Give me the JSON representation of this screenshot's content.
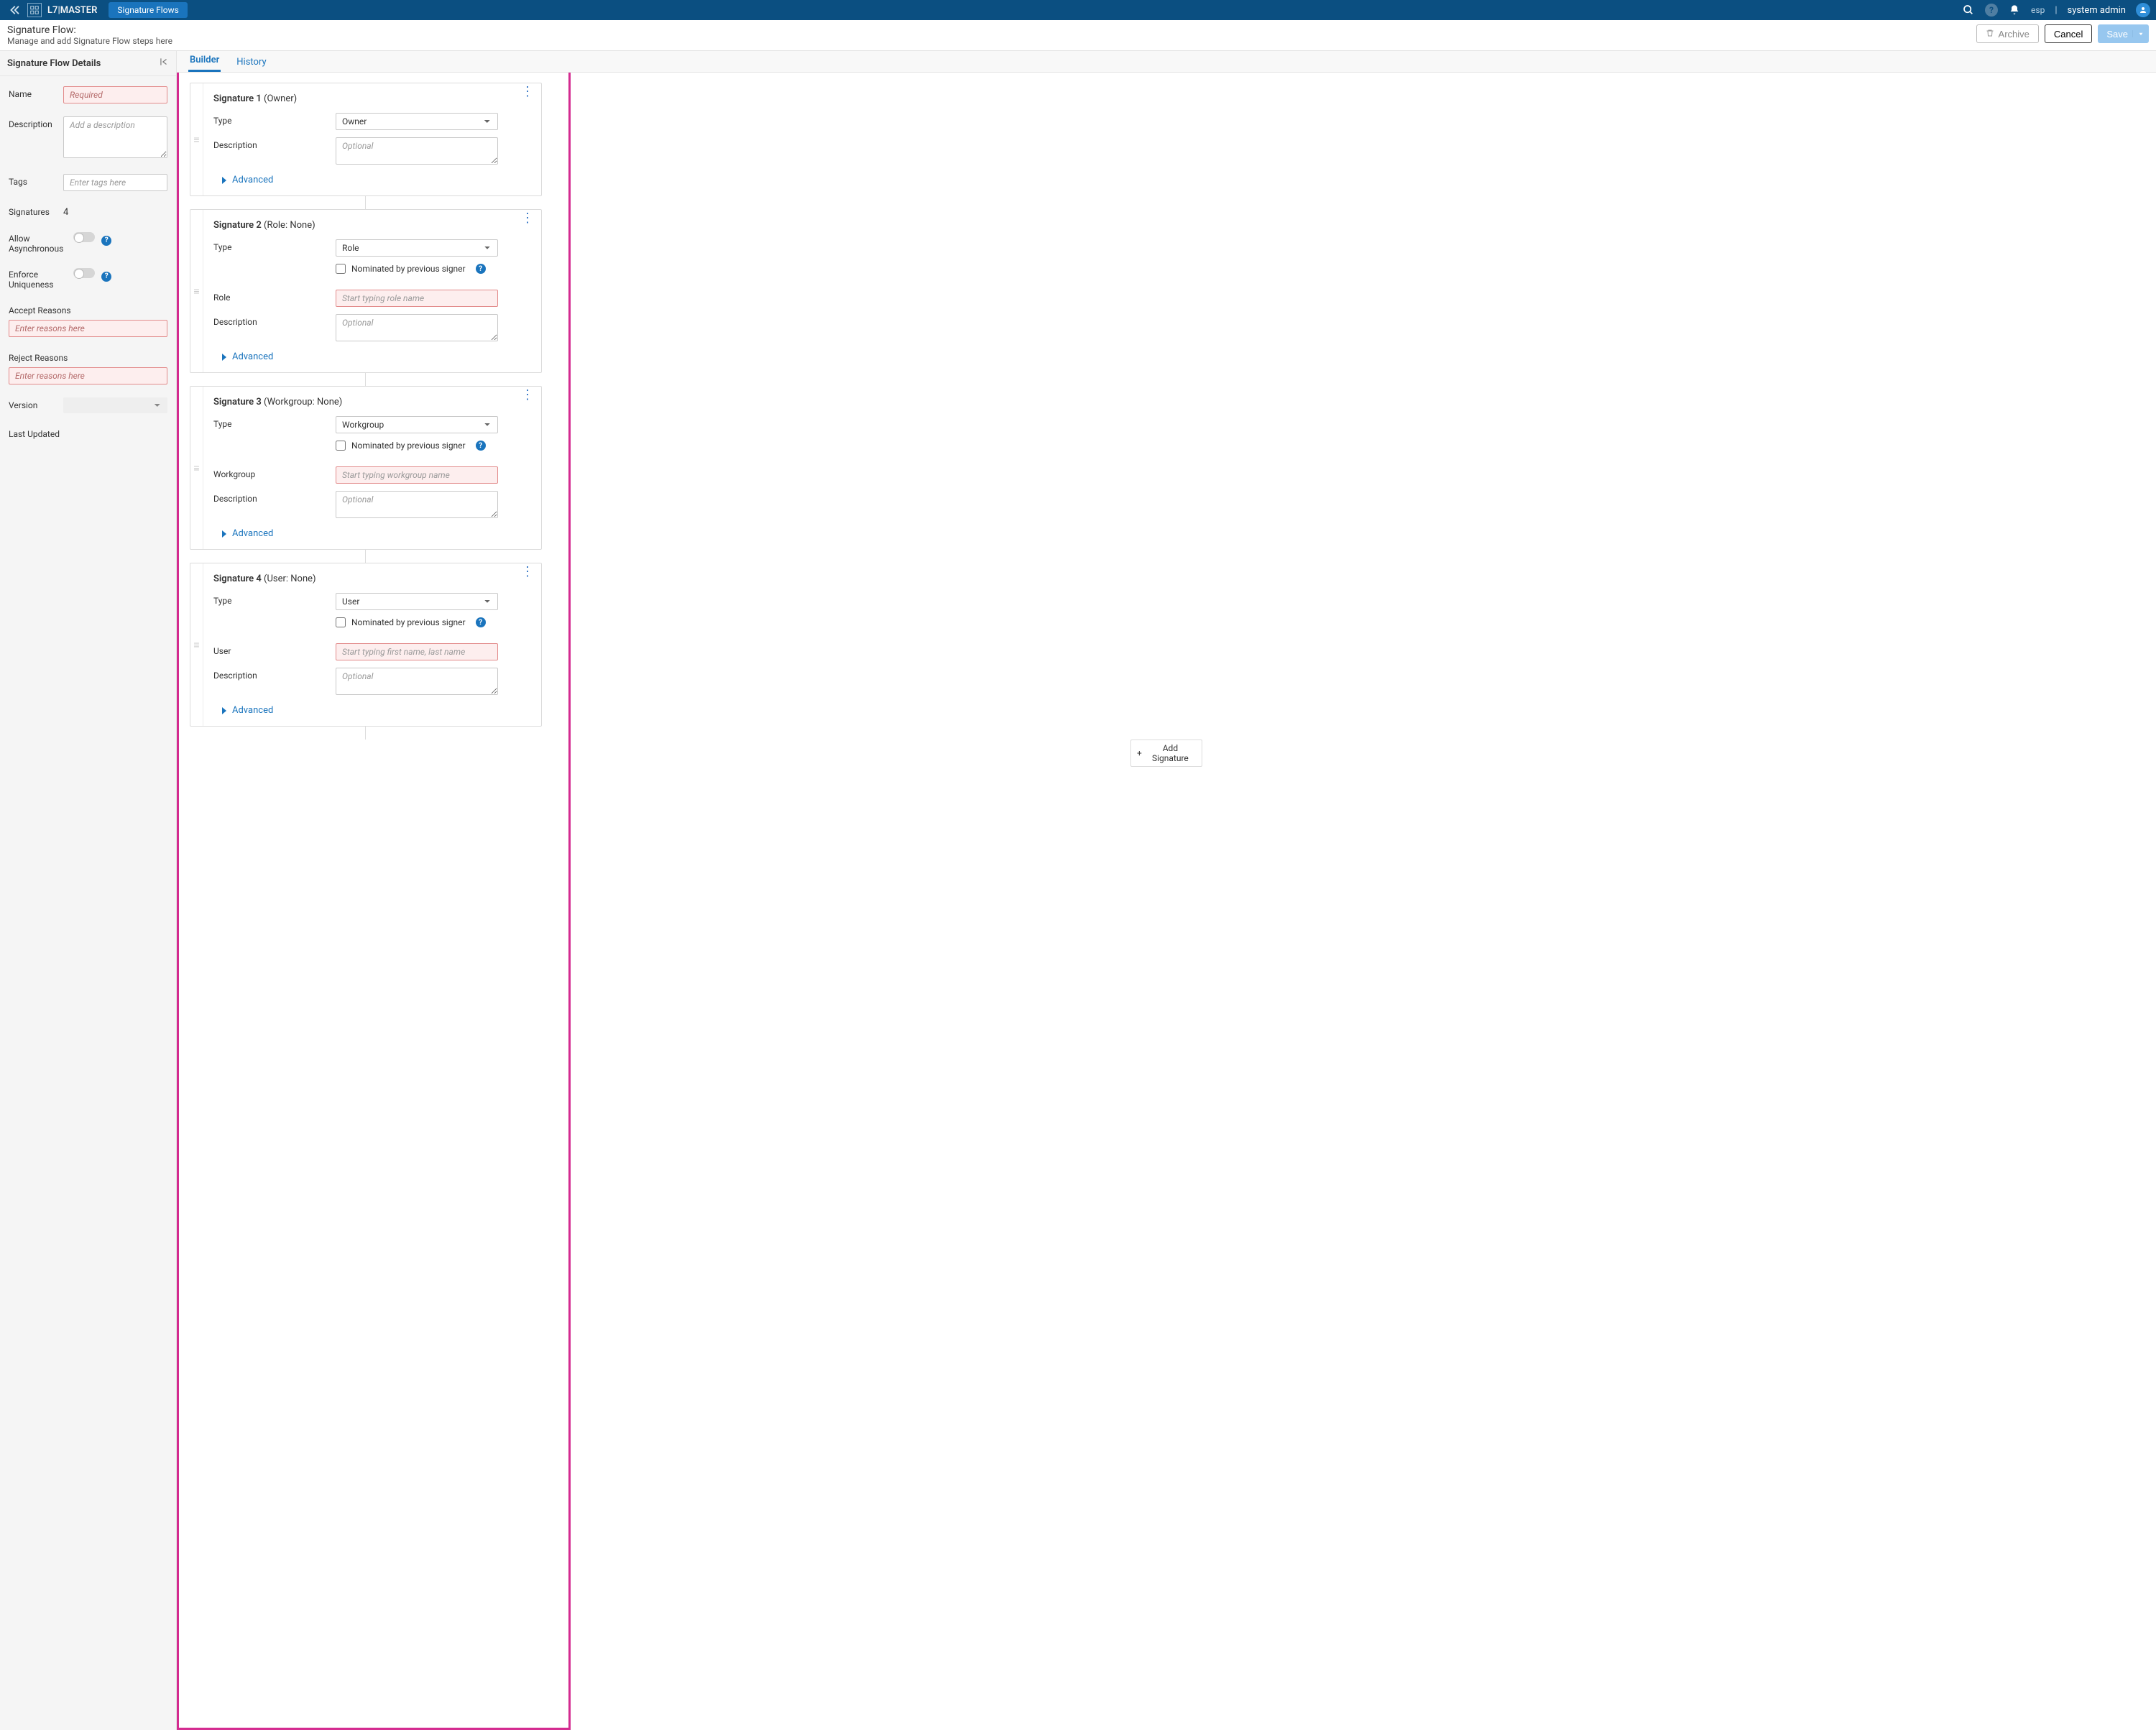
{
  "topbar": {
    "brand": "L7|MASTER",
    "activeTab": "Signature Flows",
    "locale": "esp",
    "username": "system admin"
  },
  "subheader": {
    "title": "Signature Flow:",
    "subtitle": "Manage and add Signature Flow steps here",
    "archive": "Archive",
    "cancel": "Cancel",
    "save": "Save"
  },
  "side": {
    "heading": "Signature Flow Details",
    "nameLabel": "Name",
    "namePlaceholder": "Required",
    "descLabel": "Description",
    "descPlaceholder": "Add a description",
    "tagsLabel": "Tags",
    "tagsPlaceholder": "Enter tags here",
    "signaturesLabel": "Signatures",
    "signaturesCount": "4",
    "allowAsyncLabel": "Allow Asynchronous",
    "enforceUniqLabel": "Enforce Uniqueness",
    "acceptLabel": "Accept Reasons",
    "acceptPlaceholder": "Enter reasons here",
    "rejectLabel": "Reject Reasons",
    "rejectPlaceholder": "Enter reasons here",
    "versionLabel": "Version",
    "lastUpdatedLabel": "Last Updated"
  },
  "tabs": {
    "builder": "Builder",
    "history": "History"
  },
  "labels": {
    "type": "Type",
    "description": "Description",
    "role": "Role",
    "workgroup": "Workgroup",
    "user": "User",
    "nominated": "Nominated by previous signer",
    "advanced": "Advanced",
    "descPlaceholder": "Optional",
    "addSignature": "Add Signature"
  },
  "signatures": [
    {
      "titleBold": "Signature 1",
      "titleRest": " (Owner)",
      "type": "Owner",
      "showNominated": false,
      "extraFieldLabelKey": null,
      "extraPlaceholder": null
    },
    {
      "titleBold": "Signature 2",
      "titleRest": " (Role: None)",
      "type": "Role",
      "showNominated": true,
      "extraFieldLabelKey": "role",
      "extraPlaceholder": "Start typing role name"
    },
    {
      "titleBold": "Signature 3",
      "titleRest": " (Workgroup: None)",
      "type": "Workgroup",
      "showNominated": true,
      "extraFieldLabelKey": "workgroup",
      "extraPlaceholder": "Start typing workgroup name"
    },
    {
      "titleBold": "Signature 4",
      "titleRest": " (User: None)",
      "type": "User",
      "showNominated": true,
      "extraFieldLabelKey": "user",
      "extraPlaceholder": "Start typing first name, last name"
    }
  ]
}
